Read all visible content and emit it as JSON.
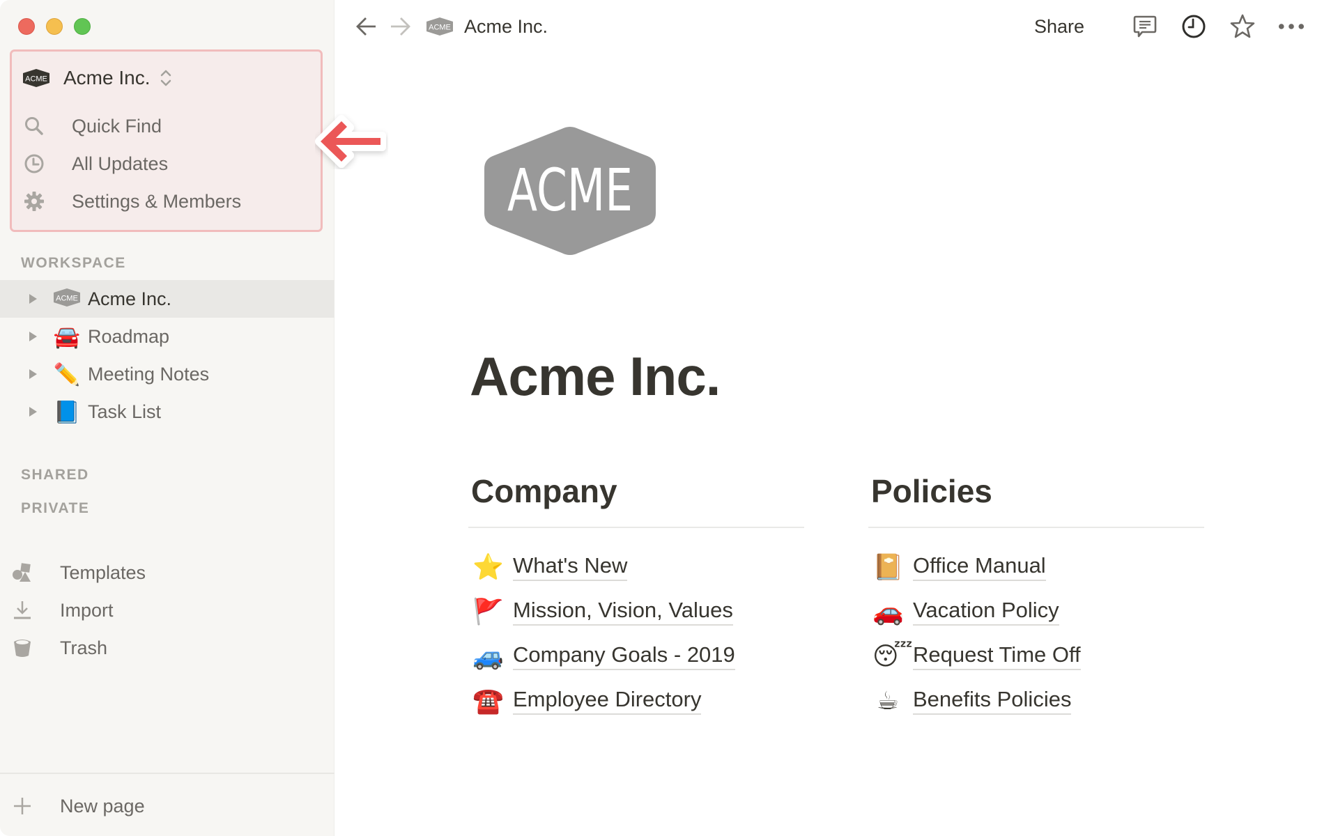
{
  "window": {
    "traffic_lights": [
      "close",
      "minimize",
      "maximize"
    ]
  },
  "sidebar": {
    "workspace_switcher": {
      "name": "Acme Inc.",
      "logo_text": "ACME"
    },
    "top_items": [
      {
        "label": "Quick Find",
        "icon": "search-icon"
      },
      {
        "label": "All Updates",
        "icon": "clock-icon"
      },
      {
        "label": "Settings & Members",
        "icon": "gear-icon"
      }
    ],
    "sections": {
      "workspace": "WORKSPACE",
      "shared": "SHARED",
      "private": "PRIVATE"
    },
    "workspace_pages": [
      {
        "label": "Acme Inc.",
        "icon": "acme-logo",
        "emoji": "",
        "selected": true
      },
      {
        "label": "Roadmap",
        "icon": "car-front-icon",
        "emoji": "🚘",
        "selected": false
      },
      {
        "label": "Meeting Notes",
        "icon": "pencil-icon",
        "emoji": "✏️",
        "selected": false
      },
      {
        "label": "Task List",
        "icon": "blue-book-icon",
        "emoji": "📘",
        "selected": false
      }
    ],
    "bottom_items": [
      {
        "label": "Templates",
        "icon": "templates-icon"
      },
      {
        "label": "Import",
        "icon": "import-icon"
      },
      {
        "label": "Trash",
        "icon": "trash-icon"
      }
    ],
    "new_page": {
      "label": "New page",
      "icon": "plus-icon"
    }
  },
  "topbar": {
    "breadcrumb": {
      "label": "Acme Inc.",
      "logo_text": "ACME"
    },
    "share_label": "Share",
    "actions": [
      "comments-icon",
      "history-clock-icon",
      "favorite-star-icon",
      "more-icon"
    ]
  },
  "page": {
    "logo_text": "ACME",
    "title": "Acme Inc.",
    "columns": [
      {
        "heading": "Company",
        "links": [
          {
            "emoji": "⭐",
            "label": "What's New"
          },
          {
            "emoji": "🚩",
            "label": "Mission, Vision, Values"
          },
          {
            "emoji": "🚙",
            "label": "Company Goals - 2019"
          },
          {
            "emoji": "☎️",
            "label": "Employee Directory"
          }
        ]
      },
      {
        "heading": "Policies",
        "links": [
          {
            "emoji": "📔",
            "label": "Office Manual"
          },
          {
            "emoji": "🚗",
            "label": "Vacation Policy"
          },
          {
            "emoji": "😴",
            "label": "Request Time Off"
          },
          {
            "emoji": "☕",
            "label": "Benefits Policies"
          }
        ]
      }
    ]
  },
  "colors": {
    "sidebar_bg": "#f7f6f3",
    "highlight_bg": "#f6eceb",
    "highlight_border": "#f1bcbc",
    "callout_arrow": "#eb5757",
    "text_primary": "#37352f",
    "text_secondary": "#6b6864"
  }
}
